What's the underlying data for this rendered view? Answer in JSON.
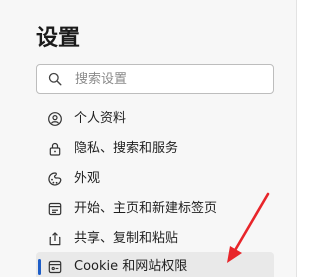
{
  "settings": {
    "title": "设置",
    "search": {
      "placeholder": "搜索设置",
      "value": ""
    },
    "nav": [
      {
        "label": "个人资料",
        "icon": "profile-icon"
      },
      {
        "label": "隐私、搜索和服务",
        "icon": "lock-icon"
      },
      {
        "label": "外观",
        "icon": "appearance-icon"
      },
      {
        "label": "开始、主页和新建标签页",
        "icon": "start-home-icon"
      },
      {
        "label": "共享、复制和粘贴",
        "icon": "share-icon"
      },
      {
        "label": "Cookie 和网站权限",
        "icon": "site-permissions-icon",
        "active": true
      }
    ]
  },
  "colors": {
    "accent": "#1e5ec8",
    "annotation_arrow": "#e8252a",
    "active_background": "#e9e9e9",
    "sidebar_background": "#f7f7f7"
  }
}
